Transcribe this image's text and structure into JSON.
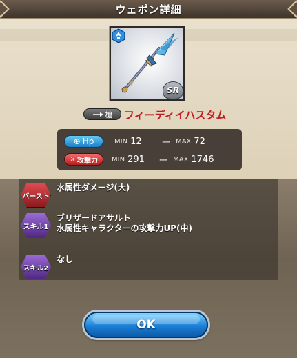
{
  "dialog": {
    "title": "ウェポン詳細"
  },
  "weapon": {
    "element_icon": "water-element-icon",
    "rarity": "SR",
    "type_label": "槍",
    "name": "フィーディイハスタム"
  },
  "stats": {
    "hp": {
      "badge": "Hp",
      "min_label": "MIN",
      "min_value": "12",
      "dash": "ー",
      "max_label": "MAX",
      "max_value": "72"
    },
    "attack": {
      "badge": "攻撃力",
      "min_label": "MIN",
      "min_value": "291",
      "dash": "ー",
      "max_label": "MAX",
      "max_value": "1746"
    }
  },
  "skills": [
    {
      "tag": "バースト",
      "lines": [
        "水属性ダメージ(大)"
      ]
    },
    {
      "tag": "スキル1",
      "lines": [
        "ブリザードアサルト",
        "水属性キャラクターの攻撃力UP(中)"
      ]
    },
    {
      "tag": "スキル2",
      "lines": [
        "なし"
      ]
    }
  ],
  "buttons": {
    "ok": "OK"
  },
  "colors": {
    "title_bar": "#4e4236",
    "weapon_name": "#c01e1e",
    "hp_badge": "#2a95d8",
    "attack_badge": "#c62828",
    "burst_hex": "#b3262b",
    "skill_hex": "#6c3fa3",
    "ok_button": "#1b7fd6"
  }
}
